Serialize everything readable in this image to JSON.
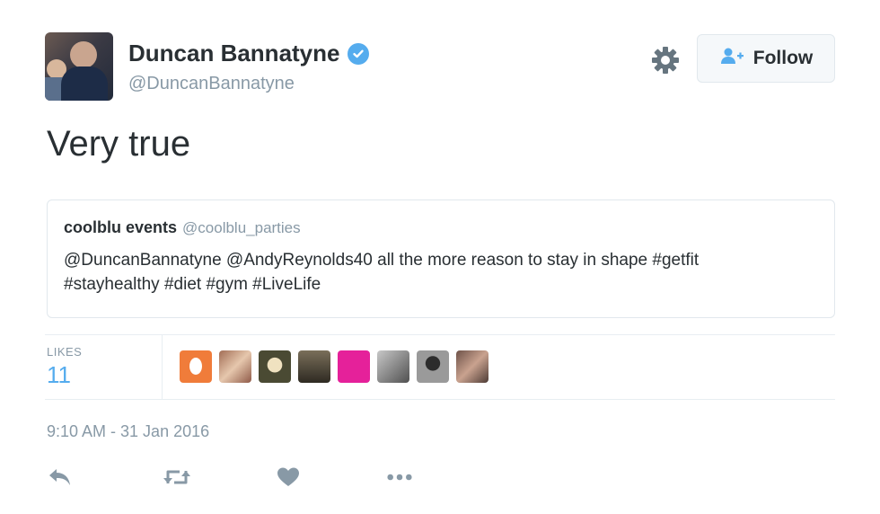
{
  "author": {
    "name": "Duncan Bannatyne",
    "handle": "@DuncanBannatyne",
    "verified": true
  },
  "follow_label": "Follow",
  "tweet_text": "Very true",
  "quoted": {
    "name": "coolblu events",
    "handle": "@coolblu_parties",
    "text_line1": "@DuncanBannatyne @AndyReynolds40 all the more reason to stay in shape #getfit",
    "text_line2": "#stayhealthy #diet #gym #LiveLife"
  },
  "stats": {
    "likes_label": "LIKES",
    "likes_count": "11"
  },
  "timestamp": "9:10 AM - 31 Jan 2016",
  "icons": {
    "verified": "verified-badge-icon",
    "settings": "gear-icon",
    "follow": "add-user-icon",
    "reply": "reply-icon",
    "retweet": "retweet-icon",
    "like": "heart-icon",
    "more": "more-icon"
  },
  "colors": {
    "accent": "#55acee",
    "text": "#292f33",
    "muted": "#8899a6",
    "border": "#e1e8ed"
  }
}
